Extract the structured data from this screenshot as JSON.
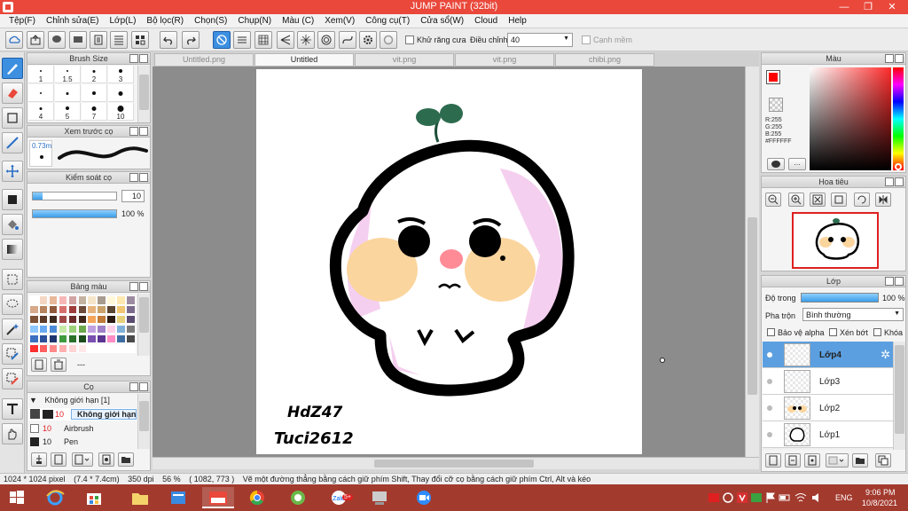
{
  "window": {
    "title": "JUMP PAINT (32bit)",
    "minimize": "—",
    "restore": "❐",
    "close": "✕"
  },
  "menu": [
    "Tệp(F)",
    "Chỉnh sửa(E)",
    "Lớp(L)",
    "Bộ lọc(R)",
    "Chọn(S)",
    "Chụp(N)",
    "Màu (C)",
    "Xem(V)",
    "Công cụ(T)",
    "Cửa sổ(W)",
    "Cloud",
    "Help"
  ],
  "toolbar": {
    "antialias_label": "Khử răng cưa",
    "adjust_label": "Điều chỉnh",
    "adjust_value": "40",
    "edge_label": "Cạnh mềm"
  },
  "brush_size": {
    "title": "Brush Size",
    "rows": [
      [
        "1",
        "1.5",
        "2",
        "3"
      ],
      [
        "",
        "",
        "",
        ""
      ],
      [
        "4",
        "5",
        "7",
        "10"
      ]
    ]
  },
  "brush_preview": {
    "title": "Xem trước cọ",
    "size": "0.73m"
  },
  "brush_control": {
    "title": "Kiểm soát cọ",
    "size_value": "10",
    "opacity_value": "100 %",
    "opacity_fraction": 1.0
  },
  "swatches_panel": {
    "title": "Bảng màu",
    "name": "---",
    "colors": [
      "#ffffff",
      "#f4d7c3",
      "#e8b89a",
      "#f7b7b7",
      "#d2a4a4",
      "#c4b2a0",
      "#f5e5c9",
      "#a79b8e",
      "#fff7d8",
      "#ffe8b0",
      "#9d8ca1",
      "#d6a98a",
      "#b5835e",
      "#8e5a3b",
      "#d86f6f",
      "#9e3c3c",
      "#6d4a3a",
      "#e6b37c",
      "#caa26a",
      "#5a4633",
      "#f2c572",
      "#7a6b8c",
      "#7d5238",
      "#5b3a28",
      "#3d2a1f",
      "#a04848",
      "#6b2b2b",
      "#40251b",
      "#f4a55a",
      "#c07a3a",
      "#2b1b12",
      "#e6d07a",
      "#5b4c72",
      "#8ec7ff",
      "#6aa9f0",
      "#4c8ad8",
      "#c6e9a8",
      "#9ccf7a",
      "#6ca84c",
      "#c0a0e0",
      "#a080c8",
      "#ffd0e8",
      "#7fb0d8",
      "#7a7a7a",
      "#3a6fc0",
      "#2c4f9a",
      "#1f3570",
      "#3e9a3e",
      "#2a702a",
      "#1c4c1c",
      "#7a50b0",
      "#5a3490",
      "#ff8cc4",
      "#3d6da0",
      "#4a4a4a",
      "#ff3030",
      "#ff6060",
      "#ff8a8a",
      "#ffb0b0",
      "#ffd4d4",
      "#ffe8e8",
      "#ffffff",
      "#ffffff",
      "#ffffff",
      "#ffffff",
      "#ffffff"
    ]
  },
  "brush_list": {
    "title": "Cọ",
    "group": "Không giới hạn [1]",
    "items": [
      {
        "size": "10",
        "name": "Không giới hạn"
      },
      {
        "size": "10",
        "name": "Airbrush"
      },
      {
        "size": "10",
        "name": "Pen"
      }
    ]
  },
  "tabs": [
    "Untitled.png",
    "Untitled",
    "vit.png",
    "vit.png",
    "chibi.png"
  ],
  "active_tab_index": 1,
  "canvas": {
    "signature_line1": "HdZ47",
    "signature_line2": "Tuci2612"
  },
  "color_panel": {
    "title": "Màu",
    "r": "R:255",
    "g": "G:255",
    "b": "B:255",
    "hex": "#FFFFFF",
    "foreground": "#ff0000",
    "background": "#000000"
  },
  "navigator": {
    "title": "Hoa tiêu",
    "accent": "#e02020"
  },
  "layers_panel": {
    "title": "Lớp",
    "opacity_label": "Độ trong",
    "opacity_value": "100 %",
    "opacity_fraction": 1.0,
    "blend_label": "Pha trộn",
    "blend_value": "Bình thường",
    "protect_alpha": "Bảo vệ alpha",
    "clipping": "Xén bớt",
    "lock": "Khóa",
    "layers": [
      "Lớp4",
      "Lớp3",
      "Lớp2",
      "Lớp1"
    ],
    "active_index": 0
  },
  "status": {
    "size": "1024 * 1024 pixel",
    "cm": "(7.4 * 7.4cm)",
    "dpi": "350 dpi",
    "zoom": "56 %",
    "coords": "( 1082, 773 )",
    "hint": "Vẽ một đường thẳng bằng cách giữ phím Shift, Thay đổi cỡ cọ bằng cách giữ phím Ctrl, Alt và kéo"
  },
  "taskbar": {
    "lang": "ENG",
    "time": "9:06 PM",
    "date": "10/8/2021",
    "badge": "5+",
    "accent": "#a33a2e"
  }
}
